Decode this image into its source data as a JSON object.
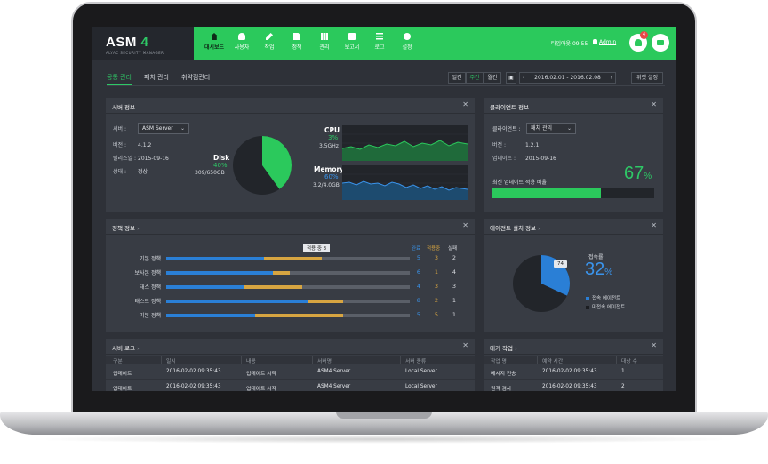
{
  "app": {
    "logo_text": "ASM",
    "logo_num": "4",
    "logo_sub": "ALYAC SECURITY MANAGER",
    "logout_timer": "타임아웃 09:55",
    "user": "Admin",
    "notification_count": "4"
  },
  "nav": [
    {
      "label": "대시보드",
      "icon": "home-icon",
      "active": true
    },
    {
      "label": "사용자",
      "icon": "users-icon"
    },
    {
      "label": "작업",
      "icon": "pencil-icon"
    },
    {
      "label": "정책",
      "icon": "document-icon"
    },
    {
      "label": "관리",
      "icon": "grid-icon"
    },
    {
      "label": "보고서",
      "icon": "clipboard-icon"
    },
    {
      "label": "로그",
      "icon": "list-icon"
    },
    {
      "label": "설정",
      "icon": "gear-icon"
    }
  ],
  "tabs": [
    {
      "label": "공통 관리",
      "active": true
    },
    {
      "label": "패치 관리"
    },
    {
      "label": "취약점관리"
    }
  ],
  "period": {
    "options": [
      "일간",
      "주간",
      "월간"
    ],
    "selected": "주간",
    "date_range": "2016.02.01 - 2016.02.08",
    "widget_settings": "위젯 설정"
  },
  "server_info": {
    "title": "서버 정보",
    "server_label": "서버 :",
    "server_value": "ASM Server",
    "version_label": "버전 :",
    "version_value": "4.1.2",
    "release_label": "릴리즈일 :",
    "release_value": "2015-09-16",
    "status_label": "상태 :",
    "status_value": "정상",
    "disk_label": "Disk",
    "disk_percent": "40%",
    "disk_percent_value": 40,
    "disk_usage": "309/650GB",
    "cpu_label": "CPU",
    "cpu_percent": "3%",
    "cpu_freq": "3.5GHz",
    "memory_label": "Memory",
    "memory_percent": "60%",
    "memory_usage": "3.2/4.0GB"
  },
  "client_info": {
    "title": "클라이언트 정보",
    "client_label": "클라이언트 :",
    "client_value": "패치 관리",
    "version_label": "버전 :",
    "version_value": "1.2.1",
    "update_label": "업데이트 :",
    "update_value": "2015-09-16",
    "latest_label": "최신 업데이트 적용 비율",
    "latest_percent": "67",
    "latest_unit": "%",
    "latest_fraction": 0.67
  },
  "policy_info": {
    "title": "정책 정보",
    "tooltip": "적용 중 3",
    "legend": [
      "완료",
      "적용중",
      "실패"
    ],
    "rows": [
      {
        "label": "기본 정책",
        "done": 5,
        "progress": 3,
        "fail": 2
      },
      {
        "label": "보사본 정책",
        "done": 6,
        "progress": 1,
        "fail": 4
      },
      {
        "label": "태스 정책",
        "done": 4,
        "progress": 3,
        "fail": 3
      },
      {
        "label": "태스트 정책",
        "done": 8,
        "progress": 2,
        "fail": 1
      },
      {
        "label": "기본 정책",
        "done": 5,
        "progress": 5,
        "fail": 1
      }
    ]
  },
  "agent_info": {
    "title": "에이전트 설치 정보",
    "connected_label": "접속률",
    "percent": "32",
    "unit": "%",
    "percent_value": 32,
    "pie_label": "74",
    "legend_connected": "접속 에이전트",
    "legend_disconnected": "미접속 에이전트"
  },
  "server_log": {
    "title": "서버 로그",
    "columns": [
      "구분",
      "일시",
      "내용",
      "서버명",
      "서버 종류"
    ],
    "rows": [
      [
        "업데이트",
        "2016-02-02  09:35:43",
        "업데이트 시작",
        "ASM4 Server",
        "Local Server"
      ],
      [
        "업데이트",
        "2016-02-02  09:35:43",
        "업데이트 시작",
        "ASM4 Server",
        "Local Server"
      ]
    ]
  },
  "waiting_jobs": {
    "title": "대기 작업",
    "columns": [
      "작업 명",
      "예약 시간",
      "대상 수"
    ],
    "rows": [
      [
        "메시지 전송",
        "2016-02-02  09:35:43",
        "1"
      ],
      [
        "원격 검사",
        "2016-02-02  09:35:43",
        "2"
      ]
    ]
  },
  "colors": {
    "accent": "#2bc95c",
    "panel": "#383c44",
    "background": "#2e3138",
    "done": "#2a7fd6",
    "progress": "#d7a541"
  }
}
